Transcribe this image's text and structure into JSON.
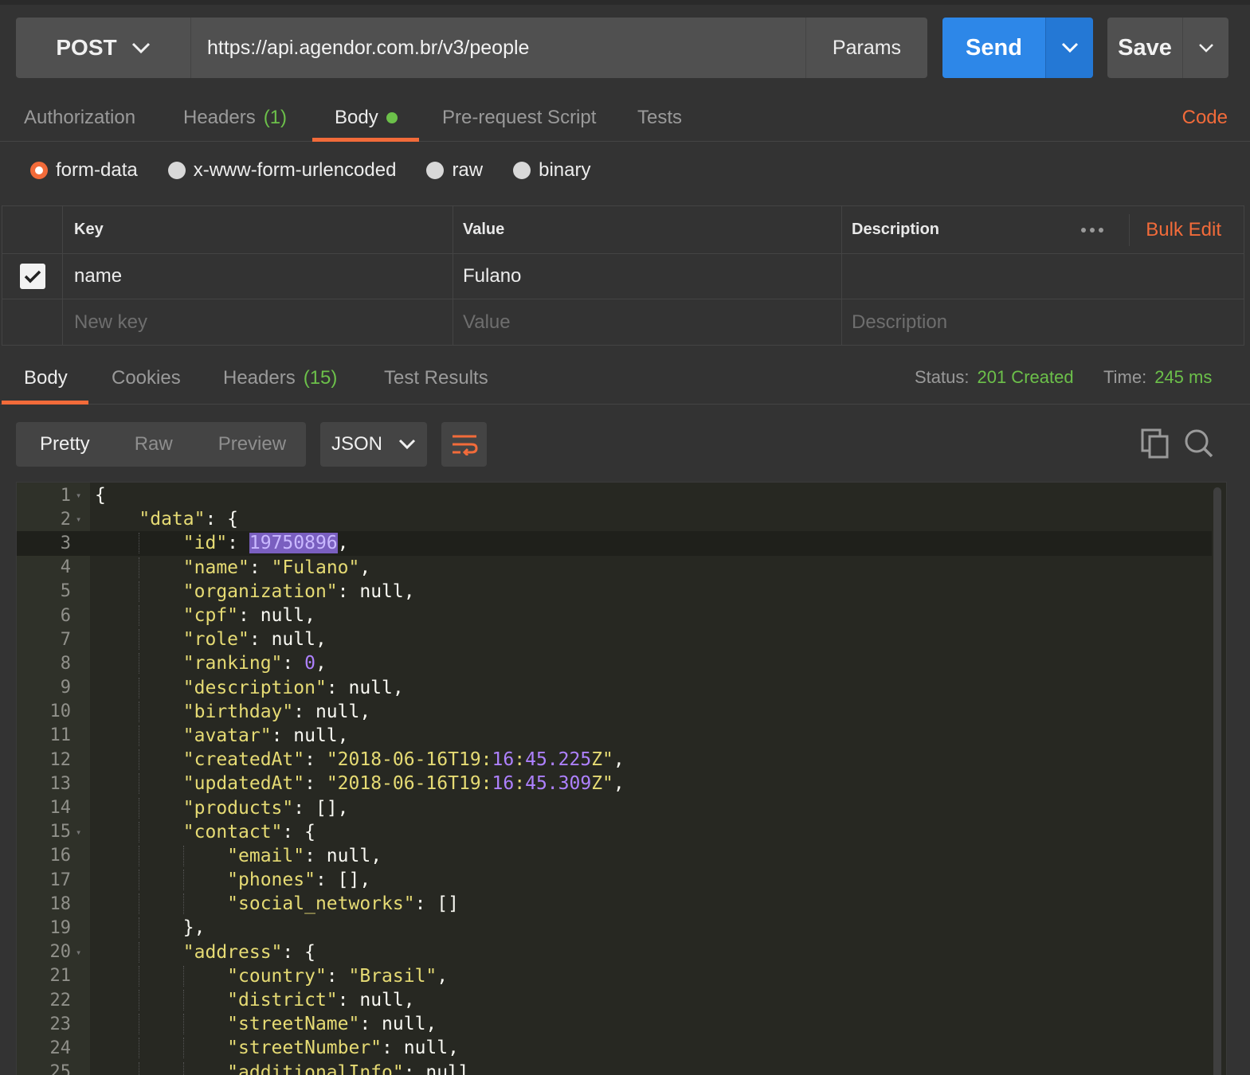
{
  "request": {
    "method": "POST",
    "url": "https://api.agendor.com.br/v3/people",
    "params_label": "Params",
    "send_label": "Send",
    "save_label": "Save"
  },
  "request_tabs": [
    {
      "label": "Authorization"
    },
    {
      "label": "Headers",
      "count": "(1)"
    },
    {
      "label": "Body",
      "active": true,
      "dot": true
    },
    {
      "label": "Pre-request Script"
    },
    {
      "label": "Tests"
    }
  ],
  "code_label": "Code",
  "body_types": [
    {
      "label": "form-data",
      "selected": true
    },
    {
      "label": "x-www-form-urlencoded"
    },
    {
      "label": "raw"
    },
    {
      "label": "binary"
    }
  ],
  "kv_table": {
    "headers": {
      "key": "Key",
      "value": "Value",
      "description": "Description"
    },
    "bulk_edit": "Bulk Edit",
    "rows": [
      {
        "checked": true,
        "key": "name",
        "value": "Fulano",
        "description": ""
      }
    ],
    "new_row": {
      "key_placeholder": "New key",
      "value_placeholder": "Value",
      "description_placeholder": "Description"
    }
  },
  "response_tabs": [
    {
      "label": "Body",
      "active": true
    },
    {
      "label": "Cookies"
    },
    {
      "label": "Headers",
      "count": "(15)"
    },
    {
      "label": "Test Results"
    }
  ],
  "status": {
    "label": "Status:",
    "value": "201 Created",
    "time_label": "Time:",
    "time_value": "245 ms"
  },
  "view_modes": [
    "Pretty",
    "Raw",
    "Preview"
  ],
  "format": "JSON",
  "colors": {
    "accent": "#f26b3a",
    "send": "#2d87e8",
    "success": "#6cc04a"
  },
  "code_lines": [
    "{",
    "    \"data\": {",
    "        \"id\": 19750896,",
    "        \"name\": \"Fulano\",",
    "        \"organization\": null,",
    "        \"cpf\": null,",
    "        \"role\": null,",
    "        \"ranking\": 0,",
    "        \"description\": null,",
    "        \"birthday\": null,",
    "        \"avatar\": null,",
    "        \"createdAt\": \"2018-06-16T19:16:45.225Z\",",
    "        \"updatedAt\": \"2018-06-16T19:16:45.309Z\",",
    "        \"products\": [],",
    "        \"contact\": {",
    "            \"email\": null,",
    "            \"phones\": [],",
    "            \"social_networks\": []",
    "        },",
    "        \"address\": {",
    "            \"country\": \"Brasil\",",
    "            \"district\": null,",
    "            \"streetName\": null,",
    "            \"streetNumber\": null,",
    "            \"additionalInfo\": null,"
  ],
  "current_line": 3,
  "selected_text": "19750896",
  "fold_lines": [
    1,
    2,
    15,
    20
  ]
}
